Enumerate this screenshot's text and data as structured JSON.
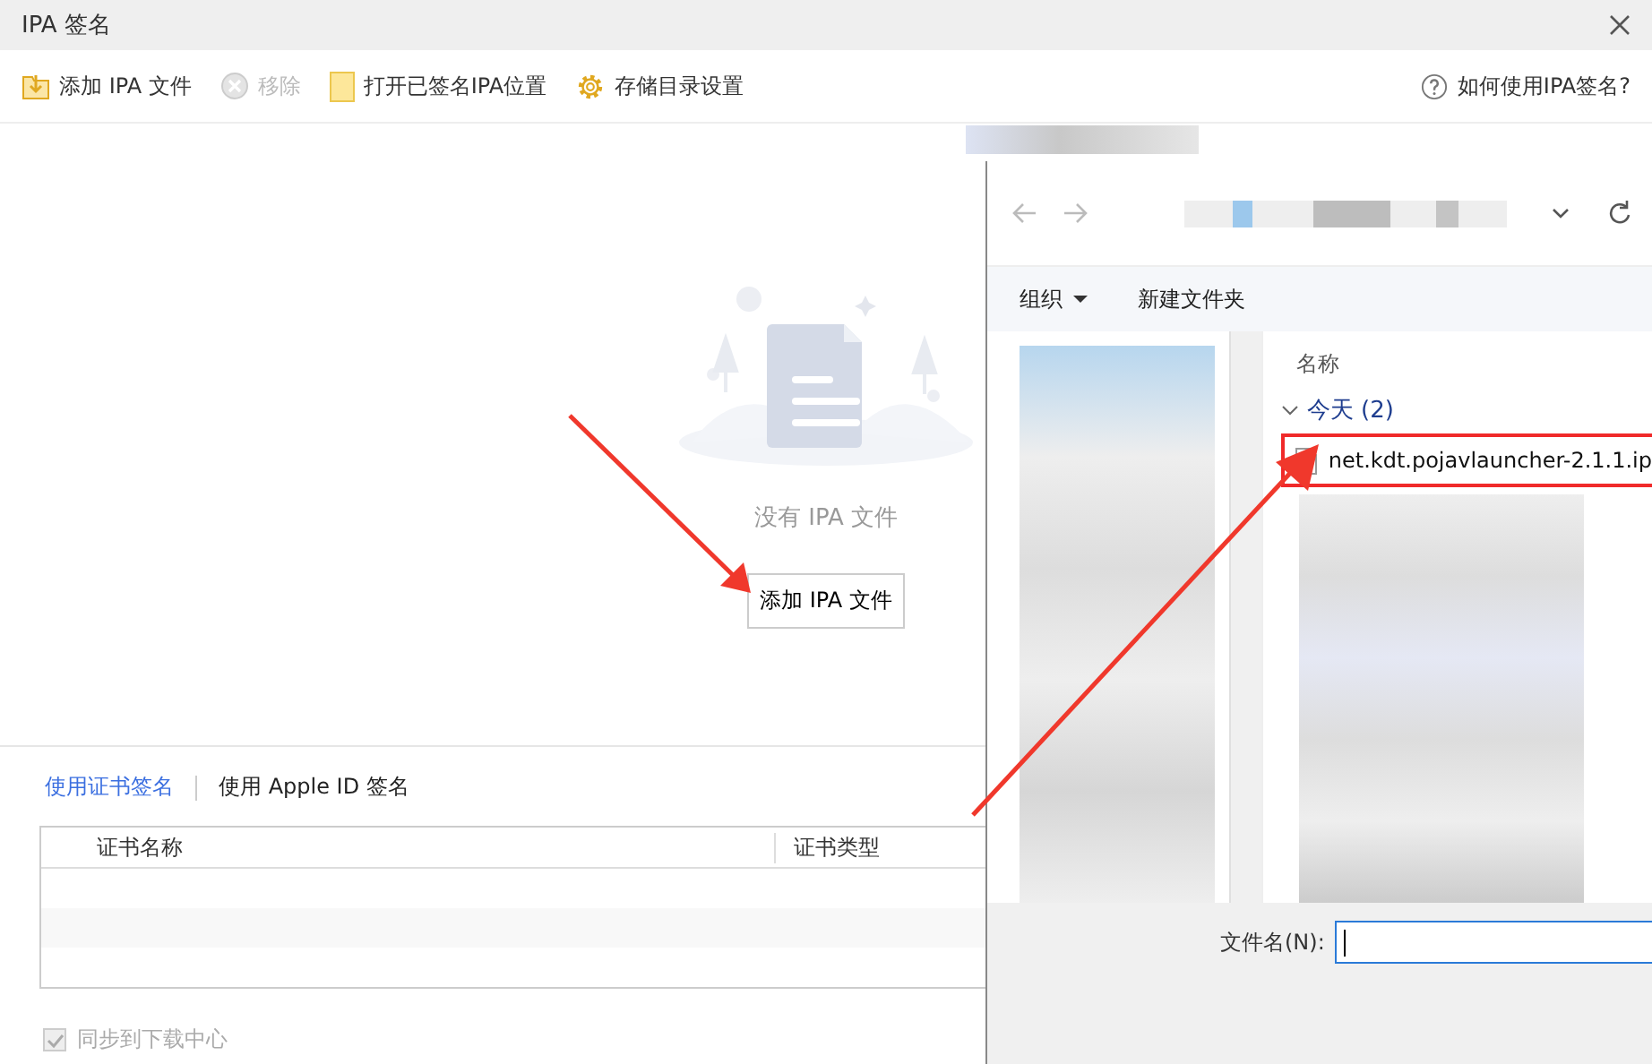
{
  "window": {
    "title": "IPA 签名"
  },
  "toolbar": [
    {
      "label": "添加 IPA 文件",
      "kind": "add",
      "disabled": false
    },
    {
      "label": "移除",
      "kind": "remove",
      "disabled": true
    },
    {
      "label": "打开已签名IPA位置",
      "kind": "folder",
      "disabled": false
    },
    {
      "label": "存储目录设置",
      "kind": "settings",
      "disabled": false
    }
  ],
  "help": {
    "label": "如何使用IPA签名?"
  },
  "empty_state": {
    "message": "没有 IPA 文件",
    "button": "添加 IPA 文件"
  },
  "sign_tabs": [
    {
      "label": "使用证书签名",
      "selected": true
    },
    {
      "label": "使用 Apple ID 签名",
      "selected": false
    }
  ],
  "table": {
    "columns": [
      "证书名称",
      "证书类型"
    ]
  },
  "sync": {
    "label": "同步到下载中心",
    "checked": true,
    "disabled": true
  },
  "file_dialog": {
    "organize": "组织",
    "new_folder": "新建文件夹",
    "column": "名称",
    "groups": [
      {
        "label": "今天 (2)",
        "files": [
          {
            "name": "net.kdt.pojavlauncher-2.1.1.ip",
            "highlighted": true
          }
        ]
      }
    ],
    "filename_label": "文件名(N):"
  }
}
